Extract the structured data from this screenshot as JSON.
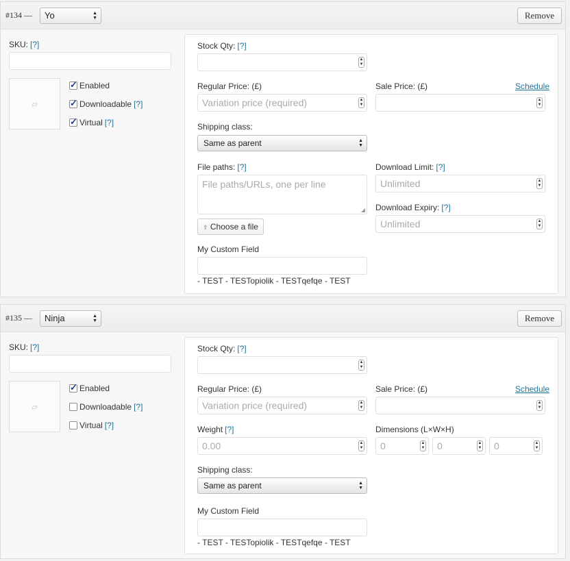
{
  "variations": [
    {
      "id": "#134 —",
      "name": "Yo",
      "remove_label": "Remove",
      "sku_label": "SKU:",
      "help": "[?]",
      "image_icon": "image-placeholder-icon",
      "enabled_label": "Enabled",
      "enabled_checked": true,
      "downloadable_label": "Downloadable",
      "downloadable_checked": true,
      "virtual_label": "Virtual",
      "virtual_checked": true,
      "stock_qty_label": "Stock Qty:",
      "regular_price_label": "Regular Price: (£)",
      "regular_price_placeholder": "Variation price (required)",
      "sale_price_label": "Sale Price: (£)",
      "schedule_label": "Schedule",
      "shipping_class_label": "Shipping class:",
      "shipping_class_value": "Same as parent",
      "file_paths_label": "File paths:",
      "file_paths_placeholder": "File paths/URLs, one per line",
      "choose_file_label": "Choose a file",
      "download_limit_label": "Download Limit:",
      "download_limit_placeholder": "Unlimited",
      "download_expiry_label": "Download Expiry:",
      "download_expiry_placeholder": "Unlimited",
      "custom_field_label": "My Custom Field",
      "custom_field_text": "- TEST - TESTopiolik - TESTqefqe - TEST"
    },
    {
      "id": "#135 —",
      "name": "Ninja",
      "remove_label": "Remove",
      "sku_label": "SKU:",
      "help": "[?]",
      "image_icon": "image-placeholder-icon",
      "enabled_label": "Enabled",
      "enabled_checked": true,
      "downloadable_label": "Downloadable",
      "downloadable_checked": false,
      "virtual_label": "Virtual",
      "virtual_checked": false,
      "stock_qty_label": "Stock Qty:",
      "regular_price_label": "Regular Price: (£)",
      "regular_price_placeholder": "Variation price (required)",
      "sale_price_label": "Sale Price: (£)",
      "schedule_label": "Schedule",
      "weight_label": "Weight",
      "weight_placeholder": "0.00",
      "dimensions_label": "Dimensions (L×W×H)",
      "dim_length_placeholder": "0",
      "dim_width_placeholder": "0",
      "dim_height_placeholder": "0",
      "shipping_class_label": "Shipping class:",
      "shipping_class_value": "Same as parent",
      "custom_field_label": "My Custom Field",
      "custom_field_text": "- TEST - TESTopiolik - TESTqefqe - TEST"
    }
  ]
}
